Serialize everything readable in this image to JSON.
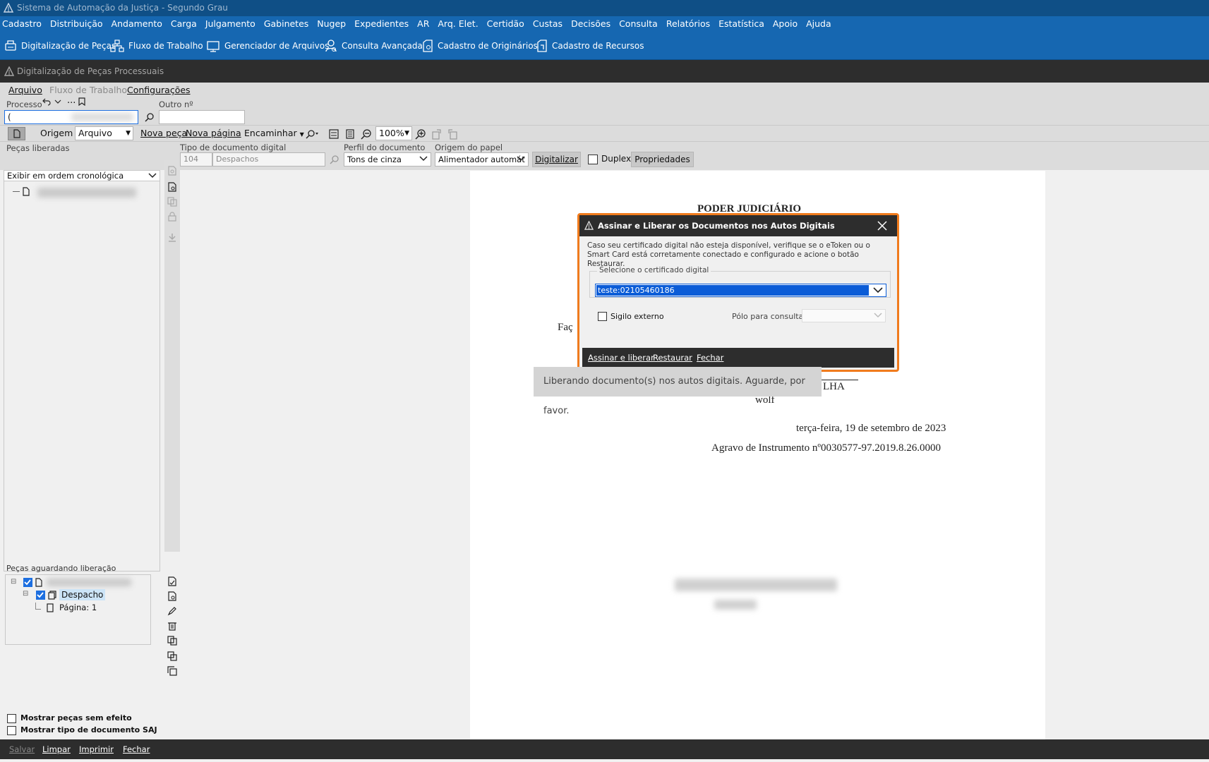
{
  "window_title": "Sistema de Automação da Justiça - Segundo Grau",
  "menu": [
    "Cadastro",
    "Distribuição",
    "Andamento",
    "Carga",
    "Julgamento",
    "Gabinetes",
    "Nugep",
    "Expedientes",
    "AR",
    "Arq. Elet.",
    "Certidão",
    "Custas",
    "Decisões",
    "Consulta",
    "Relatórios",
    "Estatística",
    "Apoio",
    "Ajuda"
  ],
  "toolbar": {
    "digitalizacao": "Digitalização de Peças",
    "fluxo": "Fluxo de Trabalho",
    "gerenciador": "Gerenciador de Arquivos",
    "consulta": "Consulta Avançada",
    "originarios": "Cadastro de Originários",
    "recursos": "Cadastro de Recursos"
  },
  "module_title": "Digitalização de Peças Processuais",
  "submenu": {
    "arquivo": "Arquivo",
    "fluxo": "Fluxo de Trabalho",
    "config": "Configurações"
  },
  "form": {
    "processo_label": "Processo",
    "processo_value": "(",
    "outro_label": "Outro nº",
    "dots": "..."
  },
  "bar2": {
    "origem": "Origem",
    "origem_value": "Arquivo",
    "nova_peca": "Nova peça",
    "nova_pagina": "Nova página",
    "encaminhar": "Encaminhar",
    "zoom": "100%"
  },
  "bar3": {
    "tipo_label": "Tipo de documento digital",
    "tipo_code": "104",
    "tipo_value": "Despachos",
    "perfil_label": "Perfil do documento",
    "perfil_value": "Tons de cinza",
    "origem_label": "Origem do papel",
    "origem_value": "Alimentador automát",
    "digitalizar": "Digitalizar",
    "duplex": "Duplex",
    "propriedades": "Propriedades"
  },
  "left": {
    "liberadas_title": "Peças liberadas",
    "ordem": "Exibir em ordem cronológica",
    "aguardando_title": "Peças aguardando liberação",
    "despacho": "Despacho",
    "pagina": "Página: 1",
    "mostrar_sem_efeito": "Mostrar peças sem efeito",
    "mostrar_tipo": "Mostrar tipo de documento SAJ"
  },
  "bottom": {
    "salvar": "Salvar",
    "limpar": "Limpar",
    "imprimir": "Imprimir",
    "fechar": "Fechar"
  },
  "document": {
    "header": "PODER JUDICIÁRIO",
    "facx": "Faç",
    "lha": "LHA",
    "wolf": "wolf",
    "date": "terça-feira, 19 de setembro de 2023",
    "agravo": "Agravo de Instrumento nº0030577-97.2019.8.26.0000"
  },
  "dialog": {
    "title": "Assinar e Liberar os Documentos nos Autos Digitais",
    "info": "Caso seu certificado digital não esteja disponível, verifique se o eToken ou o Smart Card está corretamente conectado e configurado e acione o botão Restaurar.",
    "group_label": "Selecione o certificado digital",
    "certificate": "teste:02105460186",
    "sigilo": "Sigilo externo",
    "polo": "Pólo para consulta",
    "assinar": "Assinar e liberar",
    "restaurar": "Restaurar",
    "fechar": "Fechar"
  },
  "toast": "Liberando documento(s) nos autos digitais. Aguarde, por favor.",
  "colors": {
    "accent": "#1667b1",
    "dialog_border": "#f07b1d",
    "dark": "#2d2d2d"
  }
}
